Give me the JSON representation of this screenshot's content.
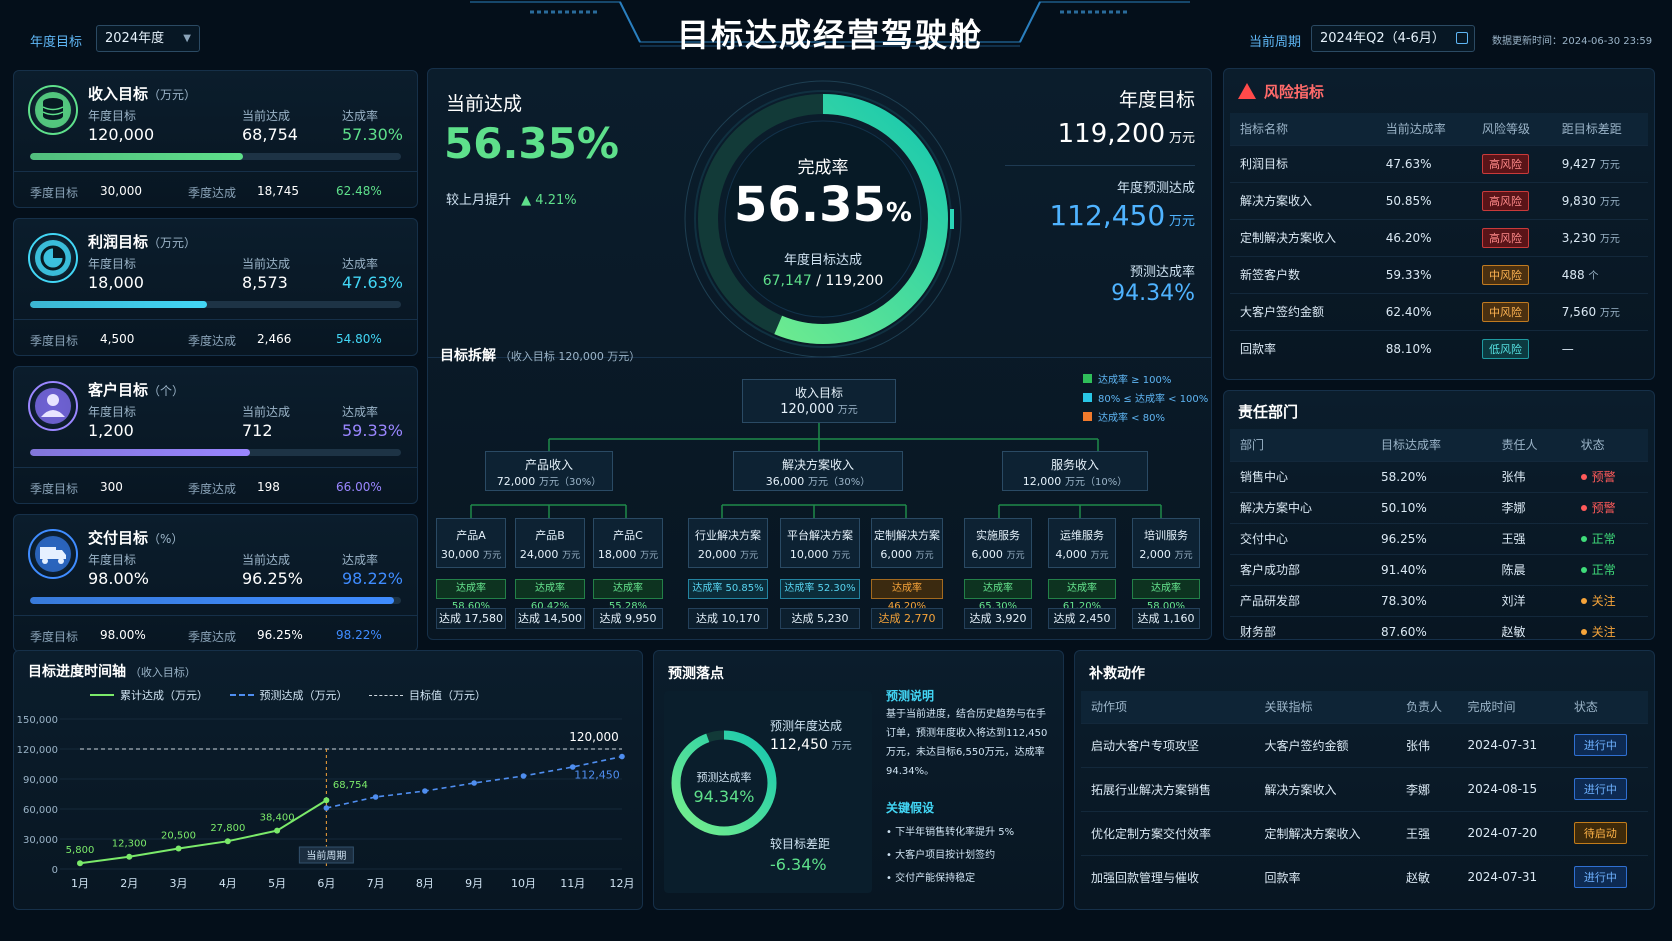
{
  "header": {
    "title": "目标达成经营驾驶舱",
    "year_label": "年度目标",
    "year_value": "2024年度",
    "period_label": "当前周期",
    "period_value": "2024年Q2（4-6月）",
    "update_text": "数据更新时间：2024-06-30 23:59"
  },
  "kpis": [
    {
      "title": "收入目标",
      "unit": "（万元）",
      "icon": "coins-icon",
      "color": "#5ee08b",
      "year_label": "年度目标",
      "year_value": "120,000",
      "cur_label": "当前达成",
      "cur_value": "68,754",
      "rate_label": "达成率",
      "rate_value": "57.30%",
      "progress": 0.573,
      "q_target_label": "季度目标",
      "q_target": "30,000",
      "q_actual_label": "季度达成",
      "q_actual": "18,745",
      "q_rate": "62.48%"
    },
    {
      "title": "利润目标",
      "unit": "（万元）",
      "icon": "pie-icon",
      "color": "#42d6f5",
      "year_label": "年度目标",
      "year_value": "18,000",
      "cur_label": "当前达成",
      "cur_value": "8,573",
      "rate_label": "达成率",
      "rate_value": "47.63%",
      "progress": 0.4763,
      "q_target_label": "季度目标",
      "q_target": "4,500",
      "q_actual_label": "季度达成",
      "q_actual": "2,466",
      "q_rate": "54.80%"
    },
    {
      "title": "客户目标",
      "unit": "（个）",
      "icon": "user-icon",
      "color": "#9a86ff",
      "year_label": "年度目标",
      "year_value": "1,200",
      "cur_label": "当前达成",
      "cur_value": "712",
      "rate_label": "达成率",
      "rate_value": "59.33%",
      "progress": 0.5933,
      "q_target_label": "季度目标",
      "q_target": "300",
      "q_actual_label": "季度达成",
      "q_actual": "198",
      "q_rate": "66.00%"
    },
    {
      "title": "交付目标",
      "unit": "（%）",
      "icon": "truck-icon",
      "color": "#3f8cff",
      "year_label": "年度目标",
      "year_value": "98.00%",
      "cur_label": "当前达成",
      "cur_value": "96.25%",
      "rate_label": "达成率",
      "rate_value": "98.22%",
      "progress": 0.9822,
      "q_target_label": "季度目标",
      "q_target": "98.00%",
      "q_actual_label": "季度达成",
      "q_actual": "96.25%",
      "q_rate": "98.22%"
    }
  ],
  "center": {
    "cur_label": "当前达成",
    "cur_rate": "56.35%",
    "mom_label": "较上月提升",
    "mom_value": "4.21%",
    "ring_title": "完成率",
    "ring_value": "56.35",
    "ring_pct": "%",
    "ring_progress": 0.5635,
    "ring_sub": "年度目标达成",
    "ring_actual": "67,147",
    "ring_target": "/ 119,200",
    "year_label": "年度目标",
    "year_value": "119,200",
    "unit": "万元",
    "forecast_label": "年度预测达成",
    "forecast_value": "112,450",
    "forecast_rate_label": "预测达成率",
    "forecast_rate": "94.34%"
  },
  "tree": {
    "title": "目标拆解",
    "subtitle": "（收入目标 120,000 万元）",
    "legend": [
      "达成率 ≥ 100%",
      "80% ≤ 达成率 < 100%",
      "达成率 < 80%"
    ],
    "root": {
      "name": "收入目标",
      "value": "120,000",
      "unit": "万元"
    },
    "groups": [
      {
        "name": "产品收入",
        "value": "72,000",
        "unit": "万元",
        "pct": "（30%）"
      },
      {
        "name": "解决方案收入",
        "value": "36,000",
        "unit": "万元",
        "pct": "（30%）"
      },
      {
        "name": "服务收入",
        "value": "12,000",
        "unit": "万元",
        "pct": "（10%）"
      }
    ],
    "leaves": [
      {
        "name": "产品A",
        "value": "30,000",
        "unit": "万元",
        "rate": "达成率 58.60%",
        "done": "达成 17,580",
        "level": "gr"
      },
      {
        "name": "产品B",
        "value": "24,000",
        "unit": "万元",
        "rate": "达成率 60.42%",
        "done": "达成 14,500",
        "level": "gr"
      },
      {
        "name": "产品C",
        "value": "18,000",
        "unit": "万元",
        "rate": "达成率 55.28%",
        "done": "达成 9,950",
        "level": "gr"
      },
      {
        "name": "行业解决方案",
        "value": "20,000",
        "unit": "万元",
        "rate": "达成率 50.85%",
        "done": "达成 10,170",
        "level": "cy"
      },
      {
        "name": "平台解决方案",
        "value": "10,000",
        "unit": "万元",
        "rate": "达成率 52.30%",
        "done": "达成 5,230",
        "level": "cy"
      },
      {
        "name": "定制解决方案",
        "value": "6,000",
        "unit": "万元",
        "rate": "达成率 46.20%",
        "done": "达成 2,770",
        "level": "or"
      },
      {
        "name": "实施服务",
        "value": "6,000",
        "unit": "万元",
        "rate": "达成率 65.30%",
        "done": "达成 3,920",
        "level": "gr"
      },
      {
        "name": "运维服务",
        "value": "4,000",
        "unit": "万元",
        "rate": "达成率 61.20%",
        "done": "达成 2,450",
        "level": "gr"
      },
      {
        "name": "培训服务",
        "value": "2,000",
        "unit": "万元",
        "rate": "达成率 58.00%",
        "done": "达成 1,160",
        "level": "gr"
      }
    ]
  },
  "risk": {
    "title": "风险指标",
    "headers": [
      "指标名称",
      "当前达成率",
      "风险等级",
      "距目标差距"
    ],
    "rows": [
      {
        "name": "利润目标",
        "rate": "47.63%",
        "level": "高风险",
        "cls": "hi",
        "gap": "9,427",
        "unit": "万元"
      },
      {
        "name": "解决方案收入",
        "rate": "50.85%",
        "level": "高风险",
        "cls": "hi",
        "gap": "9,830",
        "unit": "万元"
      },
      {
        "name": "定制解决方案收入",
        "rate": "46.20%",
        "level": "高风险",
        "cls": "hi",
        "gap": "3,230",
        "unit": "万元"
      },
      {
        "name": "新签客户数",
        "rate": "59.33%",
        "level": "中风险",
        "cls": "mid",
        "gap": "488",
        "unit": "个"
      },
      {
        "name": "大客户签约金额",
        "rate": "62.40%",
        "level": "中风险",
        "cls": "mid",
        "gap": "7,560",
        "unit": "万元"
      },
      {
        "name": "回款率",
        "rate": "88.10%",
        "level": "低风险",
        "cls": "low",
        "gap": "—",
        "unit": ""
      }
    ]
  },
  "dept": {
    "title": "责任部门",
    "headers": [
      "部门",
      "目标达成率",
      "责任人",
      "状态"
    ],
    "rows": [
      {
        "name": "销售中心",
        "rate": "58.20%",
        "owner": "张伟",
        "status": "预警",
        "color": "#ff5a5a"
      },
      {
        "name": "解决方案中心",
        "rate": "50.10%",
        "owner": "李娜",
        "status": "预警",
        "color": "#ff5a5a"
      },
      {
        "name": "交付中心",
        "rate": "96.25%",
        "owner": "王强",
        "status": "正常",
        "color": "#3fdc7a"
      },
      {
        "name": "客户成功部",
        "rate": "91.40%",
        "owner": "陈晨",
        "status": "正常",
        "color": "#3fdc7a"
      },
      {
        "name": "产品研发部",
        "rate": "78.30%",
        "owner": "刘洋",
        "status": "关注",
        "color": "#f6a43a"
      },
      {
        "name": "财务部",
        "rate": "87.60%",
        "owner": "赵敏",
        "status": "关注",
        "color": "#f6a43a"
      }
    ]
  },
  "timeline": {
    "title": "目标进度时间轴",
    "subtitle": "（收入目标）",
    "legend": [
      "累计达成（万元）",
      "预测达成（万元）",
      "目标值（万元）"
    ],
    "current_label": "当前周期"
  },
  "chart_data": {
    "type": "line",
    "x": [
      "1月",
      "2月",
      "3月",
      "4月",
      "5月",
      "6月",
      "7月",
      "8月",
      "9月",
      "10月",
      "11月",
      "12月"
    ],
    "yticks": [
      "0",
      "30,000",
      "60,000",
      "90,000",
      "120,000",
      "150,000"
    ],
    "ylim": [
      0,
      150000
    ],
    "series": [
      {
        "name": "累计达成（万元）",
        "color": "#7bea6a",
        "values": [
          5800,
          12300,
          20500,
          27800,
          38400,
          68754,
          null,
          null,
          null,
          null,
          null,
          null
        ],
        "labels": [
          "5,800",
          "12,300",
          "20,500",
          "27,800",
          "38,400",
          "68,754"
        ]
      },
      {
        "name": "预测达成（万元）",
        "color": "#4f8ef0",
        "values": [
          null,
          null,
          null,
          null,
          null,
          61000,
          72000,
          78000,
          86000,
          93000,
          102000,
          112450
        ],
        "end_label": "112,450"
      },
      {
        "name": "目标值（万元）",
        "color": "#cfd8e0",
        "values": [
          120000,
          120000,
          120000,
          120000,
          120000,
          120000,
          120000,
          120000,
          120000,
          120000,
          120000,
          120000
        ],
        "end_label": "120,000"
      }
    ]
  },
  "forecast": {
    "title": "预测落点",
    "ring_label": "预测达成率",
    "ring_value": "94.34%",
    "ring_progress": 0.9434,
    "year_label": "预测年度达成",
    "year_value": "112,450",
    "unit": "万元",
    "gap_label": "较目标差距",
    "gap_value": "-6.34%",
    "desc_title": "预测说明",
    "desc_lines": [
      "基于当前进度，结合历史趋势与在手",
      "订单，预测年度收入将达到112,450",
      "万元，未达目标6,550万元，达成率",
      "94.34%。"
    ],
    "assume_title": "关键假设",
    "assumptions": [
      "下半年销售转化率提升 5%",
      "大客户项目按计划签约",
      "交付产能保持稳定"
    ]
  },
  "actions": {
    "title": "补救动作",
    "headers": [
      "动作项",
      "关联指标",
      "负责人",
      "完成时间",
      "状态"
    ],
    "rows": [
      {
        "item": "启动大客户专项攻坚",
        "metric": "大客户签约金额",
        "owner": "张伟",
        "date": "2024-07-31",
        "status": "进行中",
        "cls": "st-blue"
      },
      {
        "item": "拓展行业解决方案销售",
        "metric": "解决方案收入",
        "owner": "李娜",
        "date": "2024-08-15",
        "status": "进行中",
        "cls": "st-blue"
      },
      {
        "item": "优化定制方案交付效率",
        "metric": "定制解决方案收入",
        "owner": "王强",
        "date": "2024-07-20",
        "status": "待启动",
        "cls": "st-orange"
      },
      {
        "item": "加强回款管理与催收",
        "metric": "回款率",
        "owner": "赵敏",
        "date": "2024-07-31",
        "status": "进行中",
        "cls": "st-blue"
      }
    ]
  }
}
